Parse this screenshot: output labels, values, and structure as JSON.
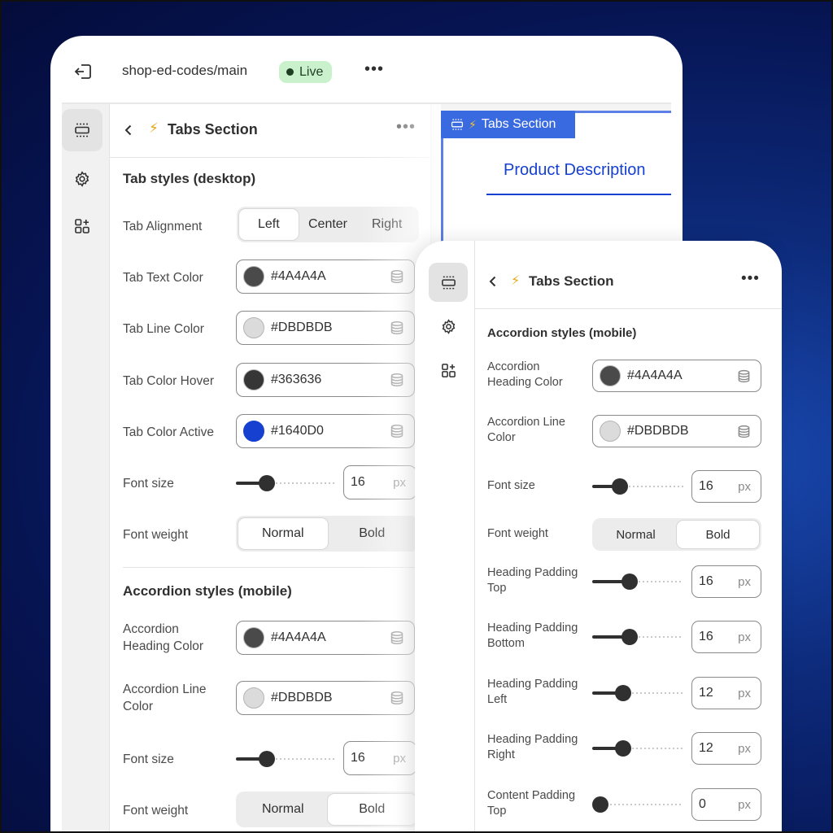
{
  "topbar": {
    "store": "shop-ed-codes/main",
    "live_label": "Live"
  },
  "panel": {
    "title": "Tabs Section",
    "desktop_section_title": "Tab styles (desktop)",
    "tab_alignment": {
      "label": "Tab Alignment",
      "options": [
        "Left",
        "Center",
        "Right"
      ],
      "selected": "Left"
    },
    "colors": [
      {
        "label": "Tab Text Color",
        "hex": "#4A4A4A",
        "swatch": "#4a4a4a"
      },
      {
        "label": "Tab Line Color",
        "hex": "#DBDBDB",
        "swatch": "#dbdbdb"
      },
      {
        "label": "Tab Color Hover",
        "hex": "#363636",
        "swatch": "#363636"
      },
      {
        "label": "Tab Color Active",
        "hex": "#1640D0",
        "swatch": "#1640d0"
      }
    ],
    "font_size": {
      "label": "Font size",
      "value": "16",
      "unit": "px"
    },
    "font_weight": {
      "label": "Font weight",
      "options": [
        "Normal",
        "Bold"
      ],
      "selected": "Normal"
    },
    "mobile_section_title": "Accordion styles (mobile)",
    "mobile_colors": [
      {
        "label_line1": "Accordion",
        "label_line2": "Heading Color",
        "hex": "#4A4A4A",
        "swatch": "#4a4a4a"
      },
      {
        "label_line1": "Accordion Line",
        "label_line2": "Color",
        "hex": "#DBDBDB",
        "swatch": "#dbdbdb"
      }
    ],
    "mobile_font_size": {
      "label": "Font size",
      "value": "16",
      "unit": "px"
    },
    "mobile_font_weight": {
      "label": "Font weight",
      "options": [
        "Normal",
        "Bold"
      ],
      "selected": "Bold"
    }
  },
  "preview": {
    "tag_label": "Tabs Section",
    "tab_title": "Product Description"
  },
  "front": {
    "title": "Tabs Section",
    "section_title": "Accordion styles (mobile)",
    "colors": [
      {
        "label_line1": "Accordion",
        "label_line2": "Heading Color",
        "hex": "#4A4A4A",
        "swatch": "#4a4a4a"
      },
      {
        "label_line1": "Accordion Line",
        "label_line2": "Color",
        "hex": "#DBDBDB",
        "swatch": "#dbdbdb"
      }
    ],
    "font_size": {
      "label": "Font size",
      "value": "16",
      "unit": "px"
    },
    "font_weight": {
      "label": "Font weight",
      "options": [
        "Normal",
        "Bold"
      ],
      "selected": "Bold"
    },
    "paddings": [
      {
        "label_line1": "Heading Padding",
        "label_line2": "Top",
        "value": "16",
        "unit": "px"
      },
      {
        "label_line1": "Heading Padding",
        "label_line2": "Bottom",
        "value": "16",
        "unit": "px"
      },
      {
        "label_line1": "Heading Padding",
        "label_line2": "Left",
        "value": "12",
        "unit": "px"
      },
      {
        "label_line1": "Heading Padding",
        "label_line2": "Right",
        "value": "12",
        "unit": "px"
      },
      {
        "label_line1": "Content Padding",
        "label_line2": "Top",
        "value": "0",
        "unit": "px"
      }
    ]
  },
  "icons": {
    "exit": "exit-icon",
    "sections": "sections-icon",
    "settings": "gear-icon",
    "apps": "apps-add-icon",
    "database": "database-icon",
    "bolt": "bolt-icon"
  },
  "accent_colors": {
    "live_badge_bg": "#c9f2cc",
    "preview_accent": "#1640d0",
    "preview_tag_bg": "#3a6ae0"
  }
}
